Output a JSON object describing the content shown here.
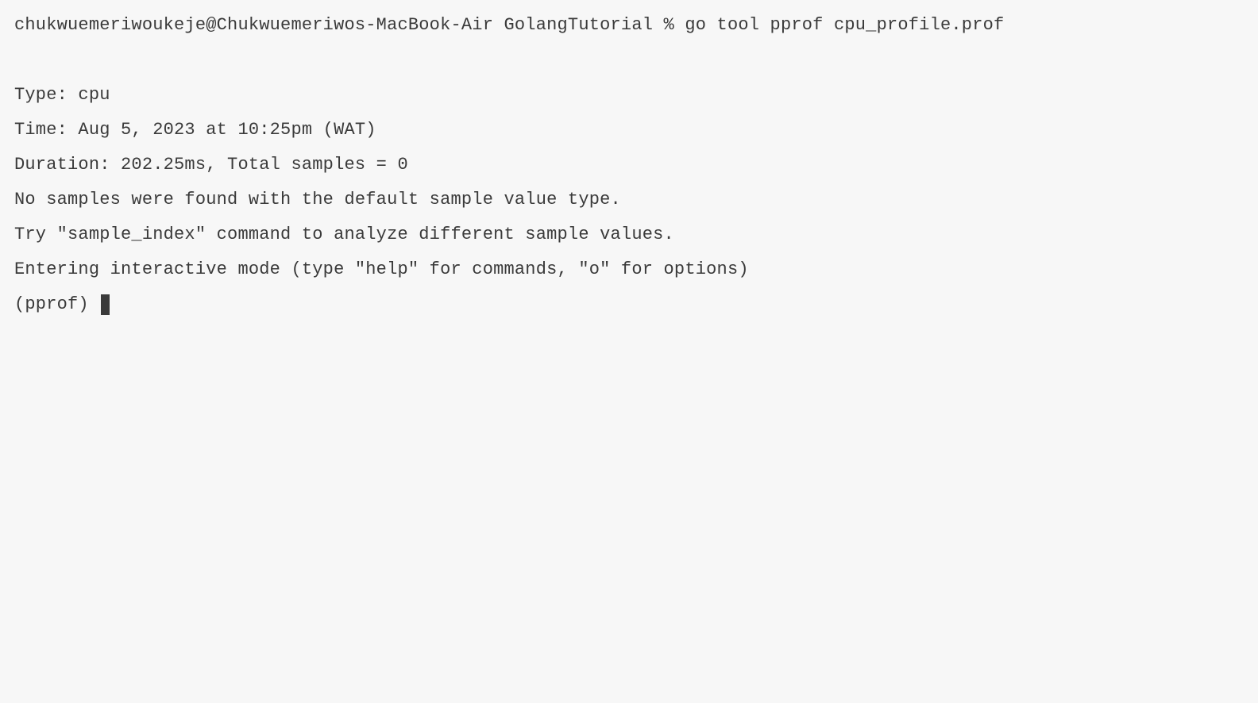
{
  "terminal": {
    "command_line": "chukwuemeriwoukeje@Chukwuemeriwos-MacBook-Air GolangTutorial % go tool pprof cpu_profile.prof",
    "output": {
      "type_line": "Type: cpu",
      "time_line": "Time: Aug 5, 2023 at 10:25pm (WAT)",
      "duration_line": "Duration: 202.25ms, Total samples = 0",
      "no_samples_line": "No samples were found with the default sample value type.",
      "try_line": "Try \"sample_index\" command to analyze different sample values.",
      "entering_line": "Entering interactive mode (type \"help\" for commands, \"o\" for options)"
    },
    "prompt": "(pprof) "
  }
}
